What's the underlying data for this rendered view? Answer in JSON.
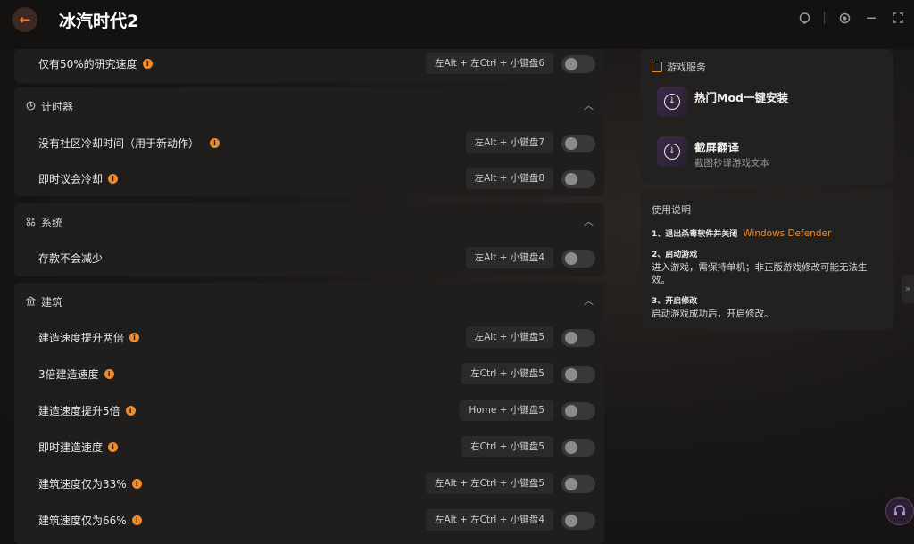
{
  "header": {
    "title": "冰汽时代2",
    "back_icon": "←"
  },
  "sections": {
    "top_row": {
      "label": "仅有50%的研究速度",
      "hotkey": "左Alt + 左Ctrl + 小键盘6"
    },
    "timer": {
      "title": "计时器",
      "rows": [
        {
          "label": "没有社区冷却时间（用于新动作）",
          "hotkey": "左Alt + 小键盘7"
        },
        {
          "label": "即时议会冷却",
          "hotkey": "左Alt + 小键盘8"
        }
      ]
    },
    "system": {
      "title": "系统",
      "rows": [
        {
          "label": "存款不会减少",
          "hotkey": "左Alt + 小键盘4"
        }
      ]
    },
    "building": {
      "title": "建筑",
      "rows": [
        {
          "label": "建造速度提升两倍",
          "hotkey": "左Alt + 小键盘5"
        },
        {
          "label": "3倍建造速度",
          "hotkey": "左Ctrl + 小键盘5"
        },
        {
          "label": "建造速度提升5倍",
          "hotkey": "Home + 小键盘5"
        },
        {
          "label": "即时建造速度",
          "hotkey": "右Ctrl + 小键盘5"
        },
        {
          "label": "建筑速度仅为33%",
          "hotkey": "左Alt + 左Ctrl + 小键盘5"
        },
        {
          "label": "建筑速度仅为66%",
          "hotkey": "左Alt + 左Ctrl + 小键盘4"
        }
      ]
    }
  },
  "services": {
    "title": "游戏服务",
    "items": [
      {
        "name": "热门Mod一键安装",
        "desc": ""
      },
      {
        "name": "截屏翻译",
        "desc": "截图秒译游戏文本"
      }
    ]
  },
  "guide": {
    "title": "使用说明",
    "step1": {
      "title": "1、退出杀毒软件并关闭",
      "highlight": "Windows Defender"
    },
    "step2": {
      "title": "2、启动游戏",
      "body": "进入游戏，需保持单机；非正版游戏修改可能无法生效。"
    },
    "step3": {
      "title": "3、开启修改",
      "body": "启动游戏成功后，开启修改。"
    }
  },
  "colors": {
    "accent": "#f08a2b",
    "card": "#201e1d",
    "bg": "#141210"
  }
}
